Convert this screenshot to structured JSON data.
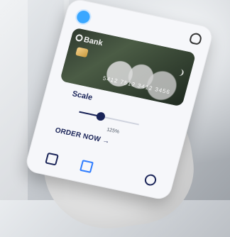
{
  "phone_ui": {
    "card": {
      "bank": "Bank",
      "number": "5412 7512 3412 3456"
    },
    "controls": {
      "scale_label": "Scale",
      "scale_value_text": "125%",
      "scale_level": 0.35,
      "order_label": "ORDER NOW →"
    },
    "icons": {
      "top_left": "globe",
      "top_right": "user",
      "bottom": [
        "gallery",
        "expand",
        "rotate"
      ]
    }
  }
}
